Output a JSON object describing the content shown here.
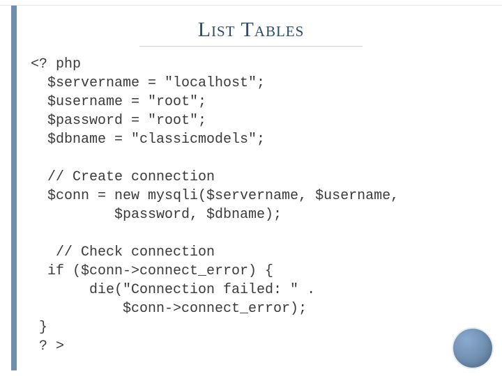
{
  "title": "List Tables",
  "code_lines": [
    "<? php",
    "  $servername = \"localhost\";",
    "  $username = \"root\";",
    "  $password = \"root\";",
    "  $dbname = \"classicmodels\";",
    "",
    "  // Create connection",
    "  $conn = new mysqli($servername, $username,",
    "          $password, $dbname);",
    "",
    "   // Check connection ",
    "  if ($conn->connect_error) {",
    "       die(\"Connection failed: \" .",
    "           $conn->connect_error);",
    " }",
    " ? >"
  ]
}
